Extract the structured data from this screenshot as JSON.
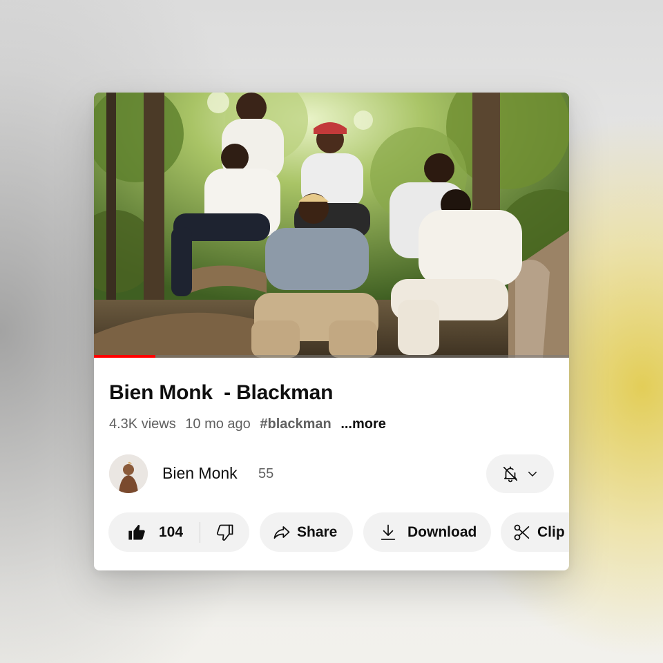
{
  "video": {
    "title": "Bien Monk  - Blackman",
    "progress_fraction": 0.13,
    "views": "4.3K views",
    "age": "10 mo ago",
    "hashtag": "#blackman",
    "more_label": "...more"
  },
  "channel": {
    "name": "Bien Monk",
    "subscribers": "55"
  },
  "actions": {
    "like_count": "104",
    "share_label": "Share",
    "download_label": "Download",
    "clip_label": "Clip"
  },
  "icons": {
    "like": "thumbs-up-icon",
    "dislike": "thumbs-down-icon",
    "share": "share-icon",
    "download": "download-icon",
    "clip": "scissors-icon",
    "notifications": "bell-off-icon",
    "dropdown": "chevron-down-icon"
  },
  "colors": {
    "progress": "#ff0000",
    "pill_background": "#f2f2f2",
    "text_primary": "#0f0f0f",
    "text_secondary": "#606060"
  }
}
